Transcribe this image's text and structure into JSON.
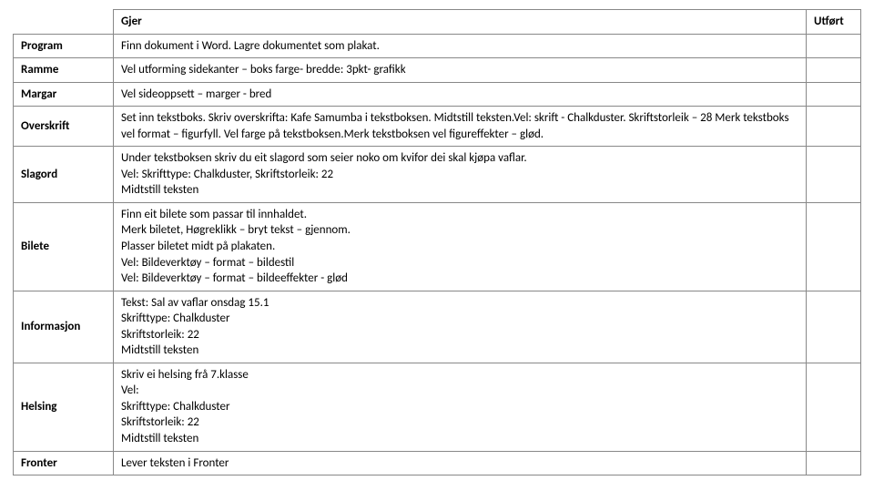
{
  "header": {
    "col_action": "Gjer",
    "col_done": "Utført"
  },
  "rows": [
    {
      "label": "Program",
      "lines": [
        "Finn dokument i Word. Lagre dokumentet som plakat."
      ]
    },
    {
      "label": "Ramme",
      "lines": [
        "Vel utforming sidekanter – boks farge- bredde: 3pkt- grafikk"
      ]
    },
    {
      "label": "Margar",
      "lines": [
        "Vel sideoppsett – marger - bred"
      ]
    },
    {
      "label": "Overskrift",
      "lines": [
        "Set inn tekstboks. Skriv overskrifta: Kafe Samumba i tekstboksen. Midtstill teksten.Vel: skrift - Chalkduster. Skriftstorleik – 28 Merk tekstboks vel format – figurfyll. Vel farge på tekstboksen.Merk tekstboksen vel figureffekter – glød."
      ]
    },
    {
      "label": "Slagord",
      "lines": [
        "Under tekstboksen skriv du eit slagord som seier noko om kvifor dei skal kjøpa vaflar.",
        "Vel: Skrifttype: Chalkduster, Skriftstorleik: 22",
        "Midtstill teksten"
      ]
    },
    {
      "label": "Bilete",
      "lines": [
        "Finn eit bilete som passar til innhaldet.",
        "Merk biletet, Høgreklikk – bryt tekst – gjennom.",
        "Plasser biletet midt på plakaten.",
        "Vel: Bildeverktøy – format – bildestil",
        "Vel: Bildeverktøy – format – bildeeffekter - glød"
      ]
    },
    {
      "label": "Informasjon",
      "lines": [
        "Tekst: Sal av vaflar onsdag 15.1",
        "Skrifttype: Chalkduster",
        "Skriftstorleik: 22",
        "Midtstill teksten"
      ]
    },
    {
      "label": "Helsing",
      "lines": [
        "Skriv ei helsing frå 7.klasse",
        "Vel:",
        "Skrifttype: Chalkduster",
        "Skriftstorleik: 22",
        "Midtstill teksten"
      ]
    },
    {
      "label": "Fronter",
      "lines": [
        "Lever teksten i Fronter"
      ]
    }
  ]
}
